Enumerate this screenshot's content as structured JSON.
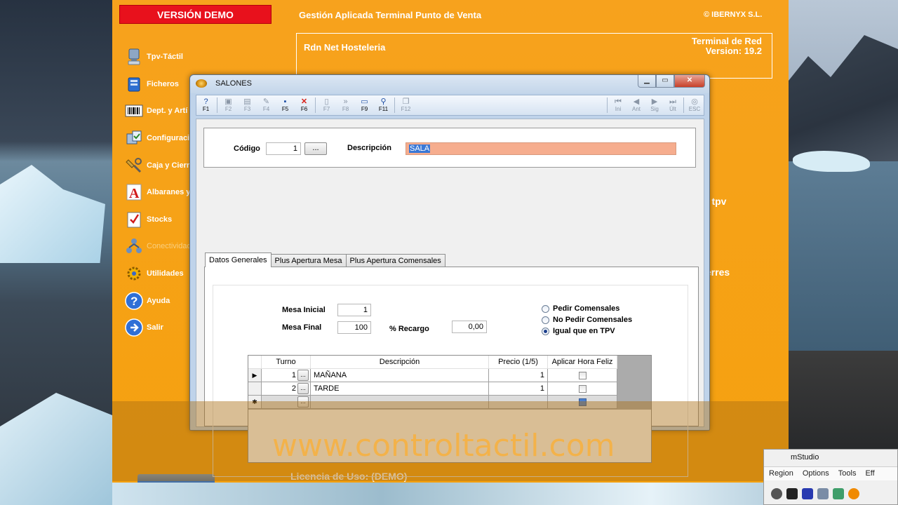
{
  "app": {
    "demo_badge": "VERSIÓN DEMO",
    "title": "Gestión Aplicada Terminal Punto de Venta",
    "copyright": "© IBERNYX S.L.",
    "header_left": "Rdn Net Hosteleria",
    "header_right_1": "Terminal de Red",
    "header_right_2": "Version: 19.2",
    "licence": "Licencia de Uso: (DEMO)",
    "side_text_1": "n tpv",
    "side_text_2": "ierres",
    "watermark": "www.controltactil.com"
  },
  "menu": {
    "items": [
      {
        "label": "Tpv-Táctil",
        "icon": "monitor-icon"
      },
      {
        "label": "Ficheros",
        "icon": "folder-icon"
      },
      {
        "label": "Dept. y Artí",
        "icon": "barcode-icon"
      },
      {
        "label": "Configuraci",
        "icon": "config-icon"
      },
      {
        "label": "Caja y Cierr",
        "icon": "tools-icon"
      },
      {
        "label": "Albaranes y",
        "icon": "letter-a-icon"
      },
      {
        "label": "Stocks",
        "icon": "checklist-icon"
      },
      {
        "label": "Conectividad",
        "icon": "network-icon"
      },
      {
        "label": "Utilidades",
        "icon": "gear-icon"
      },
      {
        "label": "Ayuda",
        "icon": "help-icon"
      },
      {
        "label": "Salir",
        "icon": "exit-icon"
      }
    ]
  },
  "dialog": {
    "title": "SALONES",
    "toolbar_left": [
      {
        "label": "F1",
        "icon": "help-icon",
        "glyph": "?",
        "state": "active"
      },
      {
        "label": "F2",
        "icon": "new-icon",
        "glyph": "▣",
        "state": "disabled"
      },
      {
        "label": "F3",
        "icon": "print-icon",
        "glyph": "▤",
        "state": "disabled"
      },
      {
        "label": "F4",
        "icon": "edit-icon",
        "glyph": "✎",
        "state": "disabled"
      },
      {
        "label": "F5",
        "icon": "save-icon",
        "glyph": "▪",
        "state": "active"
      },
      {
        "label": "F6",
        "icon": "delete-icon",
        "glyph": "✕",
        "state": "red"
      },
      {
        "label": "F7",
        "icon": "document-icon",
        "glyph": "▯",
        "state": "disabled"
      },
      {
        "label": "F8",
        "icon": "forward-icon",
        "glyph": "»",
        "state": "disabled"
      },
      {
        "label": "F9",
        "icon": "printer-icon",
        "glyph": "▭",
        "state": "active"
      },
      {
        "label": "F11",
        "icon": "search-icon",
        "glyph": "⚲",
        "state": "active"
      },
      {
        "label": "F12",
        "icon": "copy-icon",
        "glyph": "❐",
        "state": "disabled"
      }
    ],
    "toolbar_right": [
      {
        "label": "Ini",
        "icon": "first-icon",
        "glyph": "⏮"
      },
      {
        "label": "Ant",
        "icon": "previous-icon",
        "glyph": "◀"
      },
      {
        "label": "Sig",
        "icon": "next-icon",
        "glyph": "▶"
      },
      {
        "label": "Últ",
        "icon": "last-icon",
        "glyph": "⏭"
      },
      {
        "label": "ESC",
        "icon": "escape-icon",
        "glyph": "◎"
      }
    ],
    "codigo_label": "Código",
    "codigo_value": "1",
    "dots": "...",
    "descripcion_label": "Descripción",
    "descripcion_value": "SALA",
    "tabs": [
      "Datos Generales",
      "Plus Apertura Mesa",
      "Plus Apertura Comensales"
    ],
    "mesa_inicial_label": "Mesa Inicial",
    "mesa_inicial_value": "1",
    "mesa_final_label": "Mesa Final",
    "mesa_final_value": "100",
    "recargo_label": "% Recargo",
    "recargo_value": "0,00",
    "radios": [
      {
        "label": "Pedir Comensales",
        "checked": false
      },
      {
        "label": "No Pedir Comensales",
        "checked": false
      },
      {
        "label": "Igual que en TPV",
        "checked": true
      }
    ],
    "grid": {
      "headers": [
        "Turno",
        "Descripción",
        "Precio (1/5)",
        "Aplicar Hora Feliz"
      ],
      "rows": [
        {
          "marker": "▶",
          "turno": "1",
          "descripcion": "MAÑANA",
          "precio": "1"
        },
        {
          "marker": "",
          "turno": "2",
          "descripcion": "TARDE",
          "precio": "1"
        }
      ],
      "new_row_marker": "✱"
    }
  },
  "corner_window": {
    "title": "mStudio",
    "menu": [
      "Region",
      "Options",
      "Tools",
      "Eff"
    ]
  }
}
